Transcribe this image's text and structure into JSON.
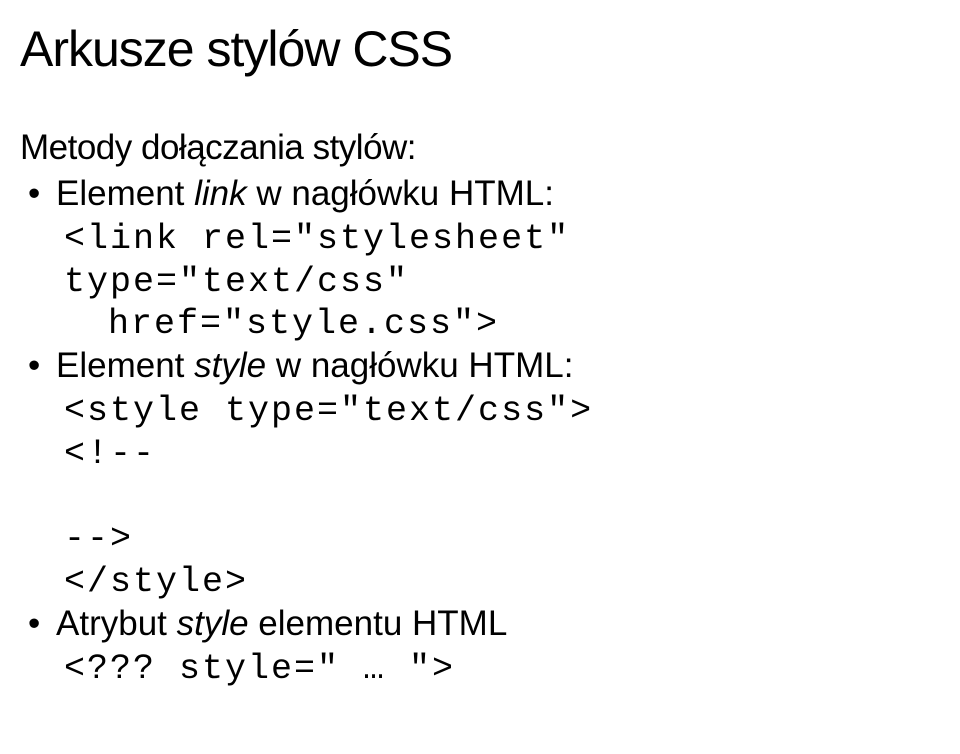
{
  "title": "Arkusze stylów CSS",
  "subtitle": "Metody dołączania stylów:",
  "items": [
    {
      "prefix": "Element ",
      "emph": "link",
      "suffix": " w nagłówku HTML:",
      "code": [
        "<link rel=\"stylesheet\" type=\"text/css\"",
        "href=\"style.css\">"
      ]
    },
    {
      "prefix": "Element ",
      "emph": "style",
      "suffix": " w nagłówku HTML:",
      "code": [
        "<style type=\"text/css\">",
        "<!--",
        "",
        "-->",
        "</style>"
      ]
    },
    {
      "prefix": "Atrybut ",
      "emph": "style",
      "suffix": " elementu HTML",
      "code": [
        "<??? style=\" … \">"
      ]
    }
  ]
}
